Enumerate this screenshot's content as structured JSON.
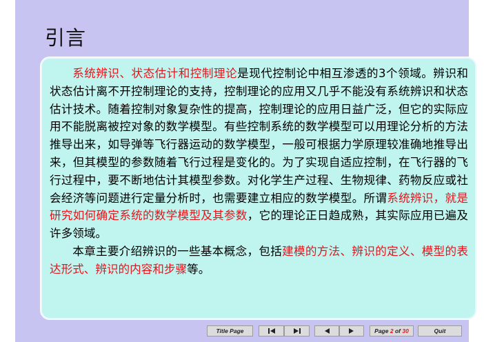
{
  "slide": {
    "title": "引言"
  },
  "content": {
    "p1": [
      {
        "text": "系统辨识、状态估计和控制理论",
        "highlight": true
      },
      {
        "text": "是现代控制论中相互渗透的3个领域。辨识和状态估计离不开控制理论的支持，控制理论的应用又几乎不能没有系统辨识和状态估计技术。随着控制对象复杂性的提高，控制理论的应用日益广泛，但它的实际应用不能脱离被控对象的数学模型。有些控制系统的数学模型可以用理论分析的方法推导出来，如导弹等飞行器运动的数学模型，一般可根据力学原理较准确地推导出来，但其模型的参数随着飞行过程是变化的。为了实现自适应控制，在飞行器的飞行过程中，要不断地估计其模型参数。对化学生产过程、生物规律、药物反应或社会经济等问题进行定量分析时，也需要建立相应的数学模型。所谓",
        "highlight": false
      },
      {
        "text": "系统辨识，就是研究如何确定系统的数学模型及其参数",
        "highlight": true
      },
      {
        "text": "，它的理论正日趋成熟，其实际应用已遍及许多领域。",
        "highlight": false
      }
    ],
    "p2": [
      {
        "text": "本章主要介绍辨识的一些基本概念，包括",
        "highlight": false
      },
      {
        "text": "建模的方法、辨识的定义、模型的表达形式、辨识的内容和步骤",
        "highlight": true
      },
      {
        "text": "等。",
        "highlight": false
      }
    ]
  },
  "nav": {
    "title_page": "Title Page",
    "first_icon": "skip-to-first-icon",
    "last_icon": "skip-to-last-icon",
    "prev_icon": "previous-icon",
    "next_icon": "next-icon",
    "page_prefix": "Page",
    "page_current": "2",
    "page_of": "of",
    "page_total": "30",
    "quit": "Quit"
  },
  "colors": {
    "slide_bg": "#c8c4f2",
    "box_bg": "#bff4ef",
    "highlight": "#e8141b",
    "button_bg": "#dcdcdc"
  }
}
